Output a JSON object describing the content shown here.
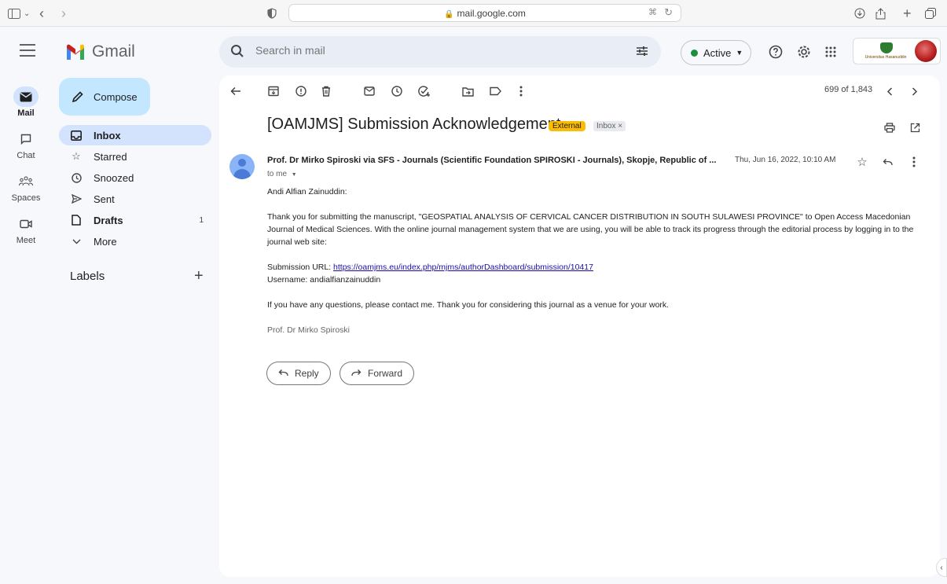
{
  "browser": {
    "url": "mail.google.com"
  },
  "app": {
    "name": "Gmail"
  },
  "search": {
    "placeholder": "Search in mail"
  },
  "status": {
    "label": "Active",
    "color": "#1e8e3e"
  },
  "account": {
    "org_logo_text": "Universitas Hasanuddin"
  },
  "rail": {
    "items": [
      {
        "label": "Mail",
        "icon": "mail-icon",
        "active": true
      },
      {
        "label": "Chat",
        "icon": "chat-icon"
      },
      {
        "label": "Spaces",
        "icon": "spaces-icon"
      },
      {
        "label": "Meet",
        "icon": "meet-icon"
      }
    ]
  },
  "sidebar": {
    "compose_label": "Compose",
    "items": [
      {
        "label": "Inbox",
        "icon": "inbox-icon",
        "active": true,
        "count": ""
      },
      {
        "label": "Starred",
        "icon": "star-icon",
        "count": ""
      },
      {
        "label": "Snoozed",
        "icon": "clock-icon",
        "count": ""
      },
      {
        "label": "Sent",
        "icon": "send-icon",
        "count": ""
      },
      {
        "label": "Drafts",
        "icon": "draft-icon",
        "count": "1"
      },
      {
        "label": "More",
        "icon": "chevron-down-icon",
        "count": ""
      }
    ],
    "labels_title": "Labels",
    "labels_add": "+"
  },
  "toolbar": {
    "pager": "699 of 1,843"
  },
  "email": {
    "subject": "[OAMJMS] Submission Acknowledgement",
    "badge_external": "External",
    "badge_inbox": "Inbox ×",
    "sender": "Prof. Dr Mirko Spiroski via SFS - Journals (Scientific Foundation SPIROSKI - Journals), Skopje, Republic of ...",
    "date": "Thu, Jun 16, 2022, 10:10 AM",
    "to": "to me",
    "greeting": "Andi Alfian Zainuddin:",
    "paragraph1": "Thank you for submitting the manuscript, \"GEOSPATIAL ANALYSIS OF CERVICAL CANCER DISTRIBUTION IN SOUTH SULAWESI PROVINCE\" to Open Access Macedonian Journal of Medical Sciences. With the online journal management system that we are using, you will be able to track its progress through the editorial process by logging in to the journal web site:",
    "submission_label": "Submission URL: ",
    "submission_url": "https://oamjms.eu/index.php/mjms/authorDashboard/submission/10417",
    "username_line": "Username: andialfianzainuddin",
    "paragraph2": "If you have any questions, please contact me. Thank you for considering this journal as a venue for your work.",
    "signature": "Prof. Dr Mirko Spiroski"
  },
  "actions": {
    "reply_label": "Reply",
    "forward_label": "Forward"
  }
}
